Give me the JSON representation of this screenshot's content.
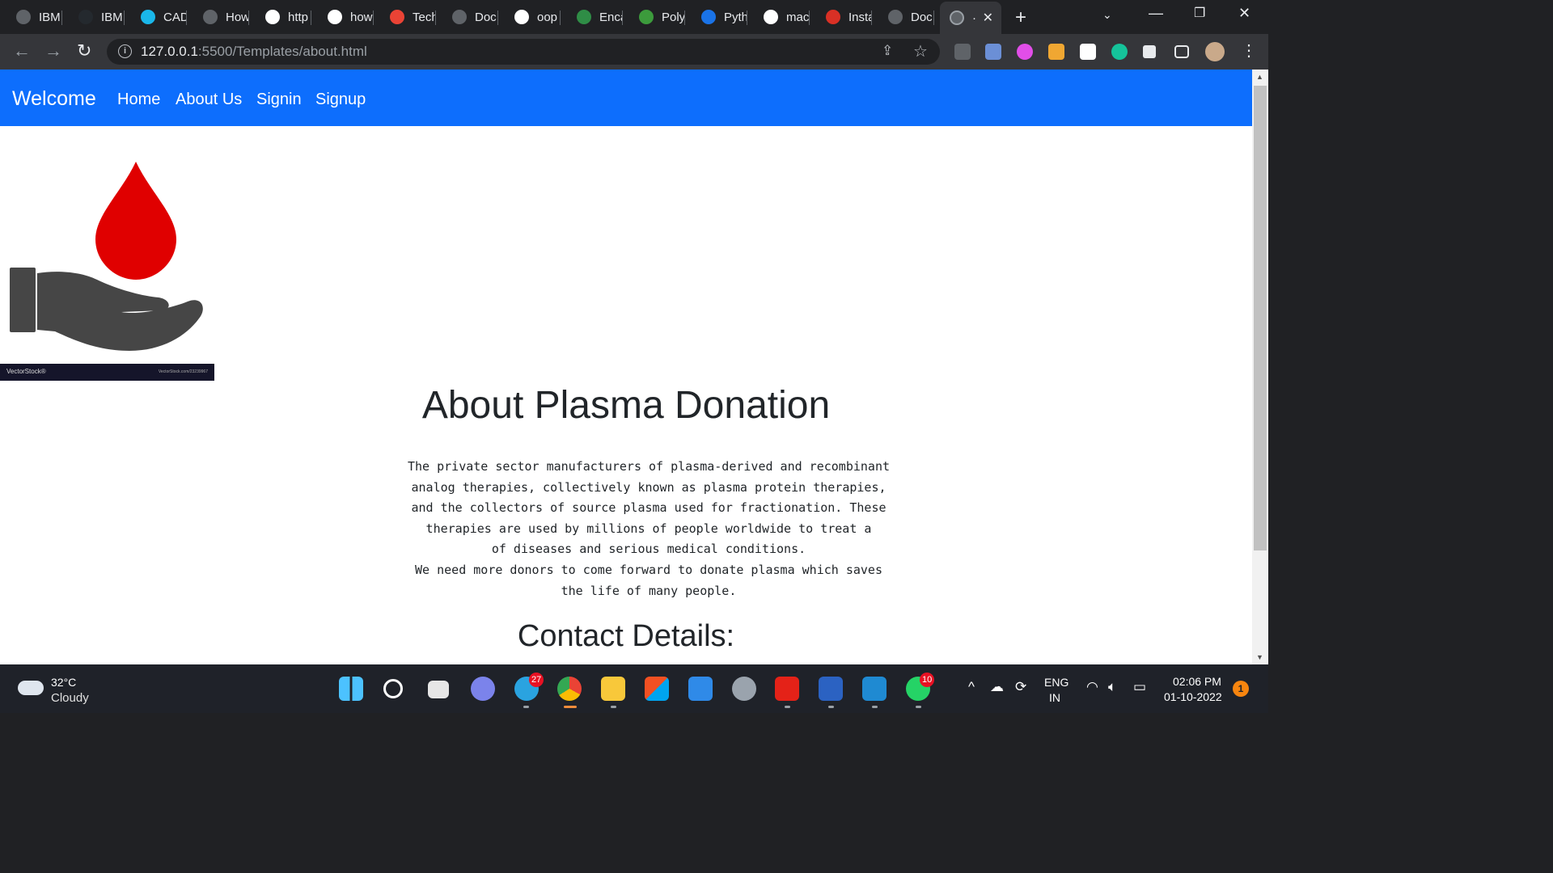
{
  "browser": {
    "tabs": [
      {
        "label": "IBM",
        "icon": "globe-icon",
        "color": "#5f6368"
      },
      {
        "label": "IBM",
        "icon": "github-icon",
        "color": "#24292e"
      },
      {
        "label": "CAD",
        "icon": "vimeo-icon",
        "color": "#1ab7ea"
      },
      {
        "label": "How",
        "icon": "link-icon",
        "color": "#5f6368"
      },
      {
        "label": "http",
        "icon": "google-icon",
        "color": "#ffffff"
      },
      {
        "label": "how",
        "icon": "google-icon",
        "color": "#ffffff"
      },
      {
        "label": "Tech",
        "icon": "gmail-icon",
        "color": "#ea4335"
      },
      {
        "label": "Doc",
        "icon": "globe-icon",
        "color": "#5f6368"
      },
      {
        "label": "oop",
        "icon": "google-icon",
        "color": "#ffffff"
      },
      {
        "label": "Enca",
        "icon": "geeksforgeeks-icon",
        "color": "#2f8d46"
      },
      {
        "label": "Poly",
        "icon": "b-icon",
        "color": "#3c9b3c"
      },
      {
        "label": "Pyth",
        "icon": "g-icon",
        "color": "#1a73e8"
      },
      {
        "label": "mac",
        "icon": "google-icon",
        "color": "#ffffff"
      },
      {
        "label": "Insta",
        "icon": "planet-icon",
        "color": "#d93025"
      },
      {
        "label": "Doc",
        "icon": "globe-icon",
        "color": "#5f6368"
      }
    ],
    "active_tab_label": "·",
    "address": {
      "host": "127.0.0.1",
      "path": ":5500/Templates/about.html"
    }
  },
  "site": {
    "brand": "Welcome",
    "nav": [
      "Home",
      "About Us",
      "Signin",
      "Signup"
    ],
    "nav_color": "#0d6efd",
    "watermark_left": "VectorStock®",
    "watermark_right": "VectorStock.com/23239967",
    "about_title": "About Plasma Donation",
    "about_lines": [
      "The private sector manufacturers of plasma-derived and recombinant",
      "analog therapies, collectively known as plasma protein therapies,",
      "and the collectors of source plasma used for fractionation. These",
      "therapies are used by millions of people worldwide to treat a",
      "of diseases and serious medical conditions.",
      "We need more donors to come forward to donate plasma which saves",
      "the life of many people."
    ],
    "contact_title": "Contact Details:"
  },
  "taskbar": {
    "weather_temp": "32°C",
    "weather_desc": "Cloudy",
    "telegram_badge": "27",
    "whatsapp_badge": "10",
    "lang_top": "ENG",
    "lang_bottom": "IN",
    "time": "02:06 PM",
    "date": "01-10-2022",
    "notifications": "1"
  }
}
